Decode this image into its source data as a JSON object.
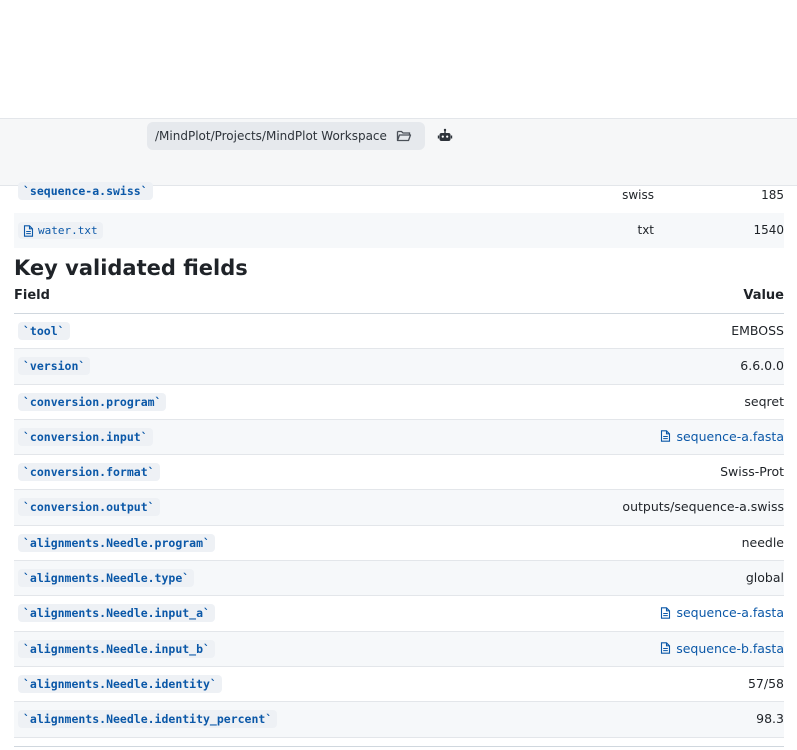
{
  "toolbar": {
    "path": "/MindPlot/Projects/MindPlot Workspace"
  },
  "files": [
    {
      "name": "`sequence-a.swiss`",
      "type": "swiss",
      "size": "185",
      "style": "code"
    },
    {
      "name": "water.txt",
      "type": "txt",
      "size": "1540",
      "style": "file"
    }
  ],
  "section": {
    "title": "Key validated fields"
  },
  "table": {
    "headers": [
      "Field",
      "Value"
    ],
    "rows": [
      {
        "field": "`tool`",
        "value": "EMBOSS"
      },
      {
        "field": "`version`",
        "value": "6.6.0.0"
      },
      {
        "field": "`conversion.program`",
        "value": "seqret"
      },
      {
        "field": "`conversion.input`",
        "value": "sequence-a.fasta"
      },
      {
        "field": "`conversion.format`",
        "value": "Swiss-Prot"
      },
      {
        "field": "`conversion.output`",
        "value": "outputs/sequence-a.swiss"
      },
      {
        "field": "`alignments.Needle.program`",
        "value": "needle"
      },
      {
        "field": "`alignments.Needle.type`",
        "value": "global"
      },
      {
        "field": "`alignments.Needle.input_a`",
        "value": "sequence-a.fasta"
      },
      {
        "field": "`alignments.Needle.input_b`",
        "value": "sequence-b.fasta"
      },
      {
        "field": "`alignments.Needle.identity`",
        "value": "57/58"
      },
      {
        "field": "`alignments.Needle.identity_percent`",
        "value": "98.3"
      }
    ]
  },
  "icons": {
    "folder": "folder-open-icon",
    "bot": "robot-icon",
    "file": "file-icon"
  },
  "colors": {
    "link": "#0b58a8",
    "toolbar_bg": "#f6f7f8",
    "pill_bg": "#e6e9ed"
  }
}
